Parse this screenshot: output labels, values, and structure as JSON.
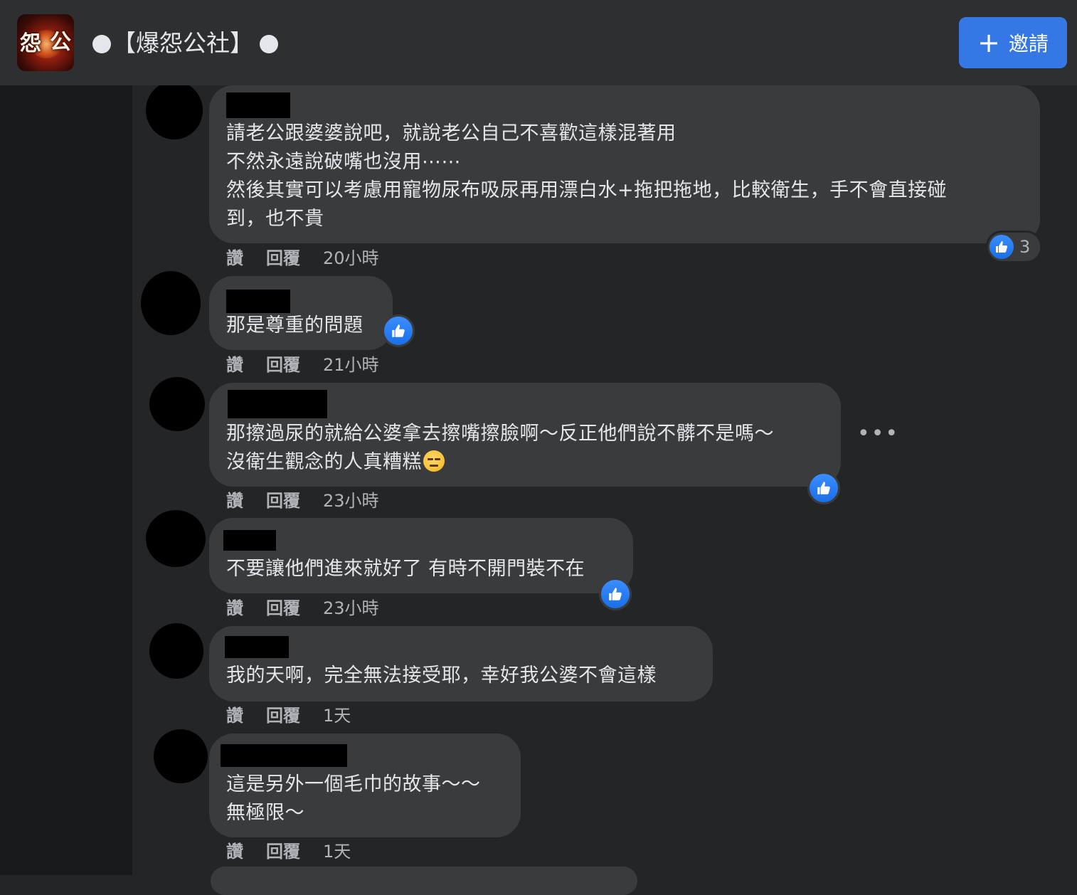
{
  "header": {
    "group_title": "【爆怨公社】",
    "logo_chars": [
      "怨",
      "公"
    ],
    "invite_label": "邀請",
    "invite_icon": "+",
    "accent_color": "#3578e5"
  },
  "actions_labels": {
    "like": "讚",
    "reply": "回覆"
  },
  "comments": [
    {
      "text": "請老公跟婆婆說吧，就說老公自己不喜歡這樣混著用\n不然永遠說破嘴也沒用⋯⋯\n然後其實可以考慮用寵物尿布吸尿再用漂白水+拖把拖地，比較衛生，手不會直接碰\n到，也不貴",
      "time": "20小時",
      "reaction_count": "3"
    },
    {
      "text": "那是尊重的問題",
      "time": "21小時"
    },
    {
      "text": "那擦過尿的就給公婆拿去擦嘴擦臉啊～反正他們說不髒不是嗎～\n沒衛生觀念的人真糟糕",
      "time": "23小時",
      "more_icon": "•••"
    },
    {
      "text": "不要讓他們進來就好了 有時不開門裝不在",
      "time": "23小時"
    },
    {
      "text": "我的天啊，完全無法接受耶，幸好我公婆不會這樣",
      "time": "1天"
    },
    {
      "text": "這是另外一個毛巾的故事～～\n無極限～",
      "time": "1天"
    }
  ],
  "colors": {
    "bubble": "#3a3b3c",
    "page": "#242526",
    "like_blue": "#1a6fe8"
  }
}
